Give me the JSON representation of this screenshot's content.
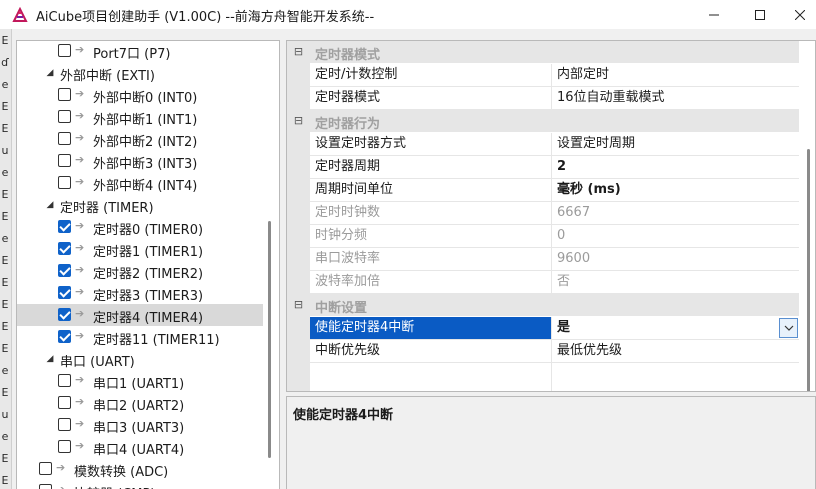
{
  "window": {
    "title": "AiCube项目创建助手 (V1.00C) --前海方舟智能开发系统--",
    "minimize_glyph": "—",
    "maximize_glyph": "☐",
    "close_glyph": "✕"
  },
  "left_strip": {
    "chars": [
      "E",
      "ɗ",
      "e",
      "E",
      "E",
      "u",
      "e",
      "E",
      "E",
      "e",
      "E",
      "E",
      "E",
      "E",
      "E",
      "e",
      "E",
      "u",
      "e",
      "E",
      "E"
    ]
  },
  "tree": {
    "items": [
      {
        "label": "Port7口 (P7)",
        "checked": false
      },
      {
        "label": "外部中断 (EXTI)",
        "group": true
      },
      {
        "label": "外部中断0 (INT0)",
        "checked": false
      },
      {
        "label": "外部中断1 (INT1)",
        "checked": false
      },
      {
        "label": "外部中断2 (INT2)",
        "checked": false
      },
      {
        "label": "外部中断3 (INT3)",
        "checked": false
      },
      {
        "label": "外部中断4 (INT4)",
        "checked": false
      },
      {
        "label": "定时器 (TIMER)",
        "group": true
      },
      {
        "label": "定时器0 (TIMER0)",
        "checked": true
      },
      {
        "label": "定时器1 (TIMER1)",
        "checked": true
      },
      {
        "label": "定时器2 (TIMER2)",
        "checked": true
      },
      {
        "label": "定时器3 (TIMER3)",
        "checked": true
      },
      {
        "label": "定时器4 (TIMER4)",
        "checked": true,
        "selected": true
      },
      {
        "label": "定时器11 (TIMER11)",
        "checked": true
      },
      {
        "label": "串口 (UART)",
        "group": true
      },
      {
        "label": "串口1 (UART1)",
        "checked": false
      },
      {
        "label": "串口2 (UART2)",
        "checked": false
      },
      {
        "label": "串口3 (UART3)",
        "checked": false
      },
      {
        "label": "串口4 (UART4)",
        "checked": false
      },
      {
        "label": "模数转换 (ADC)",
        "checked": false,
        "top_level": true
      },
      {
        "label": "比较器 (CMP)",
        "checked": false,
        "top_level": true
      }
    ]
  },
  "property_grid": {
    "categories": [
      {
        "label": "定时器模式",
        "rows": [
          {
            "name": "定时/计数控制",
            "value": "内部定时"
          },
          {
            "name": "定时器模式",
            "value": "16位自动重载模式"
          }
        ]
      },
      {
        "label": "定时器行为",
        "rows": [
          {
            "name": "设置定时器方式",
            "value": "设置定时周期"
          },
          {
            "name": "定时器周期",
            "value": "2",
            "bold": true
          },
          {
            "name": "周期时间单位",
            "value": "毫秒 (ms)",
            "bold": true
          },
          {
            "name": "定时时钟数",
            "value": "6667",
            "readonly": true
          },
          {
            "name": "时钟分频",
            "value": "0",
            "readonly": true
          },
          {
            "name": "串口波特率",
            "value": "9600",
            "readonly": true
          },
          {
            "name": "波特率加倍",
            "value": "否",
            "readonly": true
          }
        ]
      },
      {
        "label": "中断设置",
        "rows": [
          {
            "name": "使能定时器4中断",
            "value": "是",
            "selected": true
          },
          {
            "name": "中断优先级",
            "value": "最低优先级"
          }
        ]
      }
    ],
    "toggle_glyph": "⊟",
    "dropdown_glyph": "⌵"
  },
  "description": {
    "title": "使能定时器4中断"
  }
}
